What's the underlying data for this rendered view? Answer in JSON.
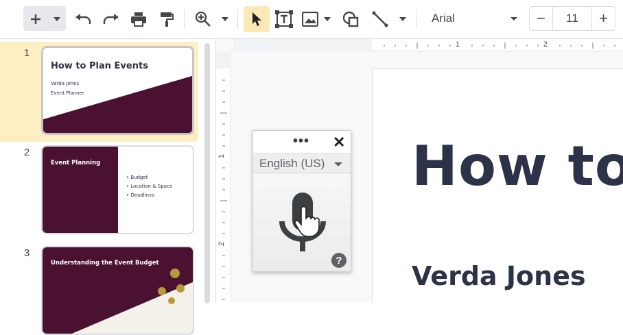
{
  "toolbar": {
    "icons": [
      "plus-icon",
      "chevron-down-icon",
      "undo-icon",
      "redo-icon",
      "print-icon",
      "paint-format-icon",
      "zoom-icon",
      "select-cursor-icon",
      "text-box-icon",
      "image-icon",
      "shape-icon",
      "line-icon"
    ],
    "font_name": "Arial",
    "font_size": "11",
    "minus_label": "−",
    "plus_label": "+"
  },
  "ruler": {
    "top_labels": [
      "1",
      "2"
    ],
    "left_labels": [
      "1",
      "2"
    ]
  },
  "slides": [
    {
      "number": "1",
      "title": "How to Plan Events",
      "lines": [
        "Verda Jones",
        "Event Planner"
      ],
      "selected": true
    },
    {
      "number": "2",
      "title": "Event Planning",
      "bullets": [
        "Budget",
        "Location & Space",
        "Deadlines"
      ]
    },
    {
      "number": "3",
      "title": "Understanding the Event Budget"
    }
  ],
  "canvas": {
    "title": "How to",
    "author": "Verda Jones"
  },
  "voice_typing": {
    "menu_label": "•••",
    "close_label": "✕",
    "language": "English (US)",
    "help_label": "?"
  },
  "colors": {
    "accent_selected": "#feefc3",
    "slide_maroon": "#4a1230",
    "title_navy": "#2c3247",
    "select_tool_highlight": "#fde9b5"
  }
}
